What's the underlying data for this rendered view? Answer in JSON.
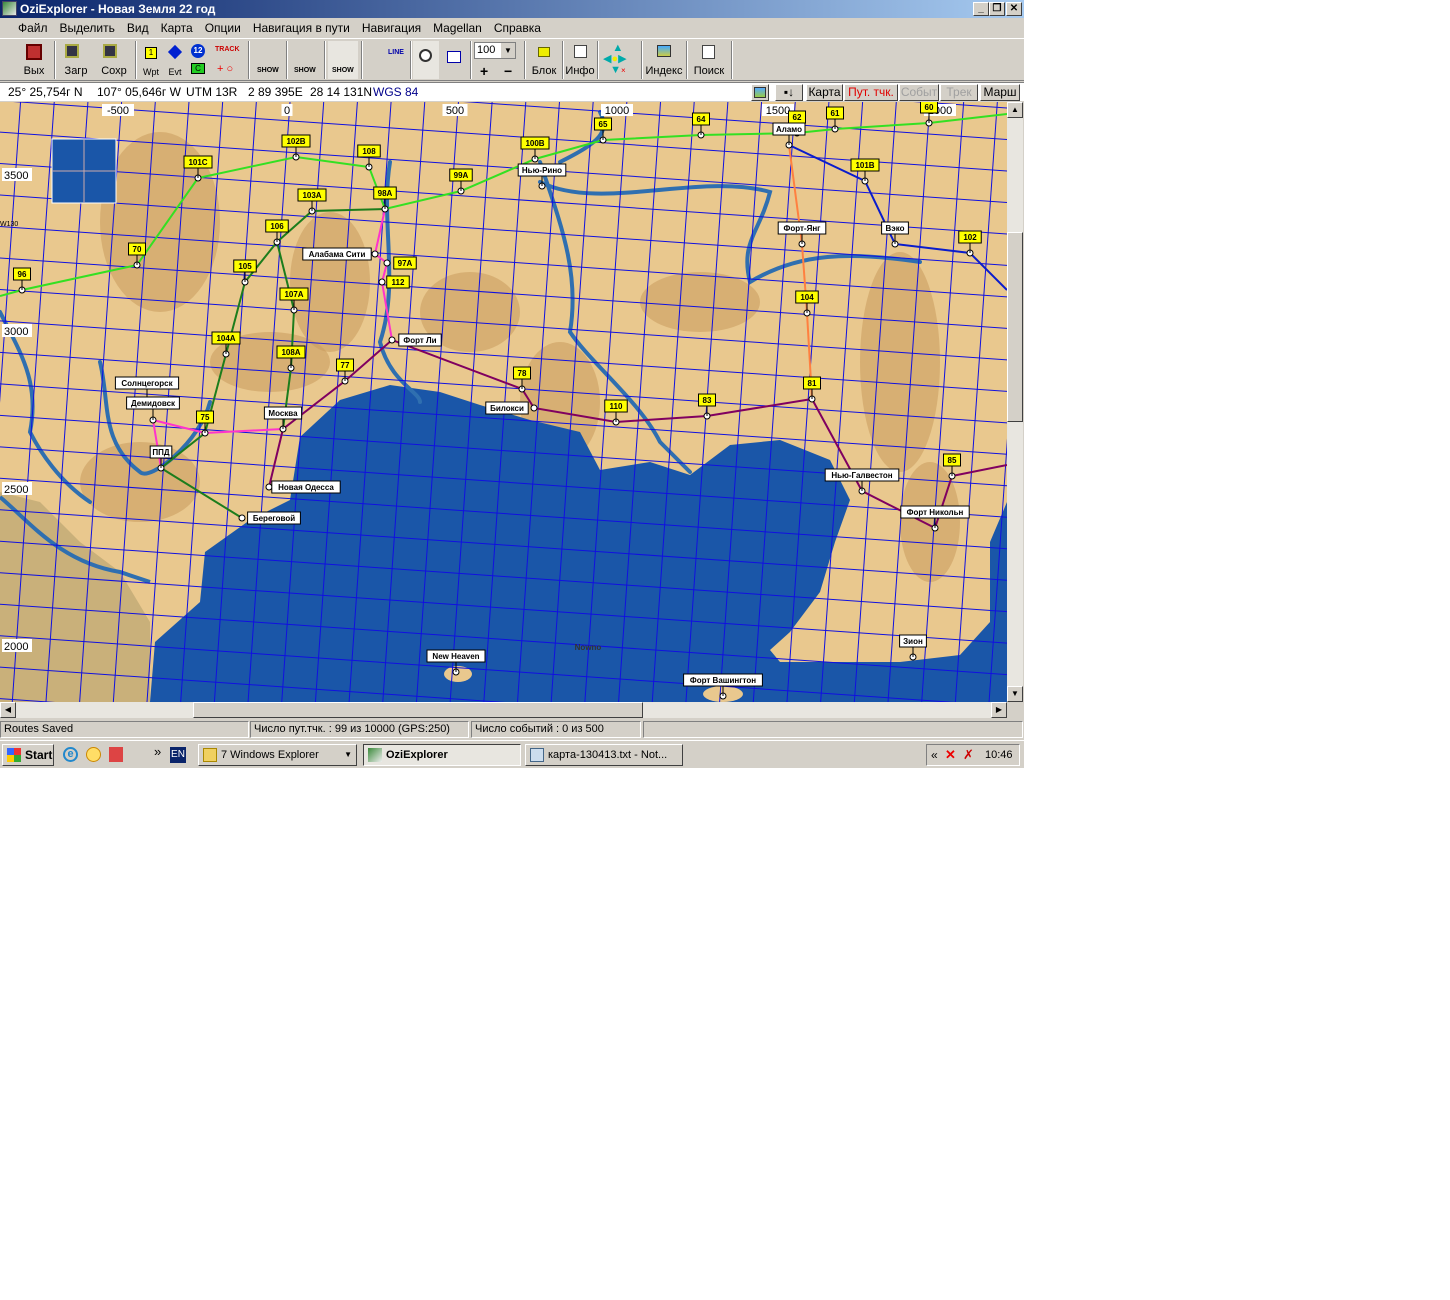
{
  "window": {
    "title": "OziExplorer - Новая Земля 22 год",
    "minimize": "_",
    "maximize": "❐",
    "close": "✕"
  },
  "menu": [
    "Файл",
    "Выделить",
    "Вид",
    "Карта",
    "Опции",
    "Навигация в пути",
    "Навигация",
    "Magellan",
    "Справка"
  ],
  "toolbar": {
    "exit": "Вых",
    "load": "Загр",
    "save": "Сохр",
    "wpt": "Wpt",
    "evt": "Evt",
    "wpt_num": "1",
    "evt_num": "12",
    "track": "TRACK",
    "c": "C",
    "show": "SHOW",
    "zoom_value": "100",
    "lock": "Блок",
    "info": "Инфо",
    "index": "Индекс",
    "search": "Поиск",
    "line": "LINE"
  },
  "coords": {
    "lat": "25° 25,754г N",
    "lon": "107° 05,646г W",
    "utm": "UTM  13R",
    "east": "2 89 395E",
    "north": "28 14 131N",
    "datum": "WGS 84"
  },
  "view_buttons": [
    {
      "label": "Карта",
      "active": false
    },
    {
      "label": "Пут. тчк.",
      "active": true
    },
    {
      "label": "Событ",
      "disabled": true
    },
    {
      "label": "Трек",
      "disabled": true
    },
    {
      "label": "Марш",
      "active": false
    }
  ],
  "map": {
    "colors": {
      "land": "#e9c88e",
      "sea": "#1a56a8",
      "grid": "#1010e0",
      "river": "#2f6fb0"
    },
    "x_ticks": [
      "-500",
      "0",
      "500",
      "1000",
      "1500",
      "2000"
    ],
    "y_ticks": [
      "3500",
      "3000",
      "2500",
      "2000"
    ],
    "edge_label": "W130",
    "waypoints": [
      {
        "label": "96",
        "style": "num"
      },
      {
        "label": "70",
        "style": "num"
      },
      {
        "label": "101C",
        "style": "num"
      },
      {
        "label": "102B",
        "style": "num"
      },
      {
        "label": "108",
        "style": "num"
      },
      {
        "label": "103A",
        "style": "num"
      },
      {
        "label": "98A",
        "style": "num"
      },
      {
        "label": "99A",
        "style": "num"
      },
      {
        "label": "106",
        "style": "num"
      },
      {
        "label": "105",
        "style": "num"
      },
      {
        "label": "107A",
        "style": "num"
      },
      {
        "label": "104A",
        "style": "num"
      },
      {
        "label": "108A",
        "style": "num"
      },
      {
        "label": "77",
        "style": "num"
      },
      {
        "label": "75",
        "style": "num"
      },
      {
        "label": "97A",
        "style": "num"
      },
      {
        "label": "112",
        "style": "num"
      },
      {
        "label": "100B",
        "style": "num"
      },
      {
        "label": "65",
        "style": "num"
      },
      {
        "label": "64",
        "style": "num"
      },
      {
        "label": "62",
        "style": "num"
      },
      {
        "label": "61",
        "style": "num"
      },
      {
        "label": "60",
        "style": "num"
      },
      {
        "label": "101B",
        "style": "num"
      },
      {
        "label": "102",
        "style": "num"
      },
      {
        "label": "104",
        "style": "num"
      },
      {
        "label": "81",
        "style": "num"
      },
      {
        "label": "83",
        "style": "num"
      },
      {
        "label": "110",
        "style": "num"
      },
      {
        "label": "78",
        "style": "num"
      },
      {
        "label": "85",
        "style": "num"
      },
      {
        "label": "Алабама Сити",
        "style": "name"
      },
      {
        "label": "Форт Ли",
        "style": "name"
      },
      {
        "label": "Москва",
        "style": "name"
      },
      {
        "label": "Солнцегорск",
        "style": "name"
      },
      {
        "label": "Демидовск",
        "style": "name"
      },
      {
        "label": "ППД",
        "style": "name"
      },
      {
        "label": "Новая Одесса",
        "style": "name"
      },
      {
        "label": "Береговой",
        "style": "name"
      },
      {
        "label": "Нью-Рино",
        "style": "name"
      },
      {
        "label": "Билокси",
        "style": "name"
      },
      {
        "label": "Аламо",
        "style": "name"
      },
      {
        "label": "Форт-Янг",
        "style": "name"
      },
      {
        "label": "Вэко",
        "style": "name"
      },
      {
        "label": "Нью-Галвестон",
        "style": "name"
      },
      {
        "label": "Форт Никольн",
        "style": "name"
      },
      {
        "label": "Зион",
        "style": "name"
      },
      {
        "label": "New Heaven",
        "style": "name"
      },
      {
        "label": "Форт Вашингтон",
        "style": "name"
      },
      {
        "label": "Nowno",
        "style": "plain"
      }
    ],
    "routes": [
      {
        "color": "#33e022",
        "points": [
          "96",
          "70",
          "101C",
          "102B",
          "108",
          "98A",
          "99A",
          "100B",
          "65",
          "64",
          "62",
          "61",
          "60"
        ]
      },
      {
        "color": "#1c7d1c",
        "points": [
          "98A",
          "103A",
          "106",
          "105",
          "104A",
          "75",
          "ППД",
          "Береговой"
        ]
      },
      {
        "color": "#1c7d1c",
        "points": [
          "106",
          "107A",
          "108A",
          "Москва"
        ]
      },
      {
        "color": "#ff33cc",
        "points": [
          "98A",
          "Алабама Сити",
          "97A",
          "112",
          "Форт Ли"
        ]
      },
      {
        "color": "#ff33cc",
        "points": [
          "ППД",
          "Демидовск",
          "75",
          "Москва"
        ]
      },
      {
        "color": "#800060",
        "points": [
          "Новая Одесса",
          "Москва",
          "77",
          "Форт Ли",
          "78",
          "Билокси",
          "110",
          "83",
          "81",
          "Нью-Галвестон",
          "Форт Никольн",
          "85"
        ]
      },
      {
        "color": "#ff8040",
        "points": [
          "Аламо",
          "Форт-Янг",
          "104",
          "81"
        ]
      },
      {
        "color": "#0a1ccc",
        "points": [
          "Аламо",
          "101B",
          "Вэко",
          "102"
        ]
      }
    ]
  },
  "status": {
    "message": "Routes Saved",
    "waypoints": "Число пут.тчк. : 99 из 10000  (GPS:250)",
    "events": "Число событий : 0 из 500"
  },
  "taskbar": {
    "start": "Start",
    "lang": "EN",
    "chevron": "»",
    "tasks": [
      "7 Windows Explorer",
      "OziExplorer",
      "карта-130413.txt - Not..."
    ],
    "tray_chevron": "«",
    "clock": "10:46"
  }
}
